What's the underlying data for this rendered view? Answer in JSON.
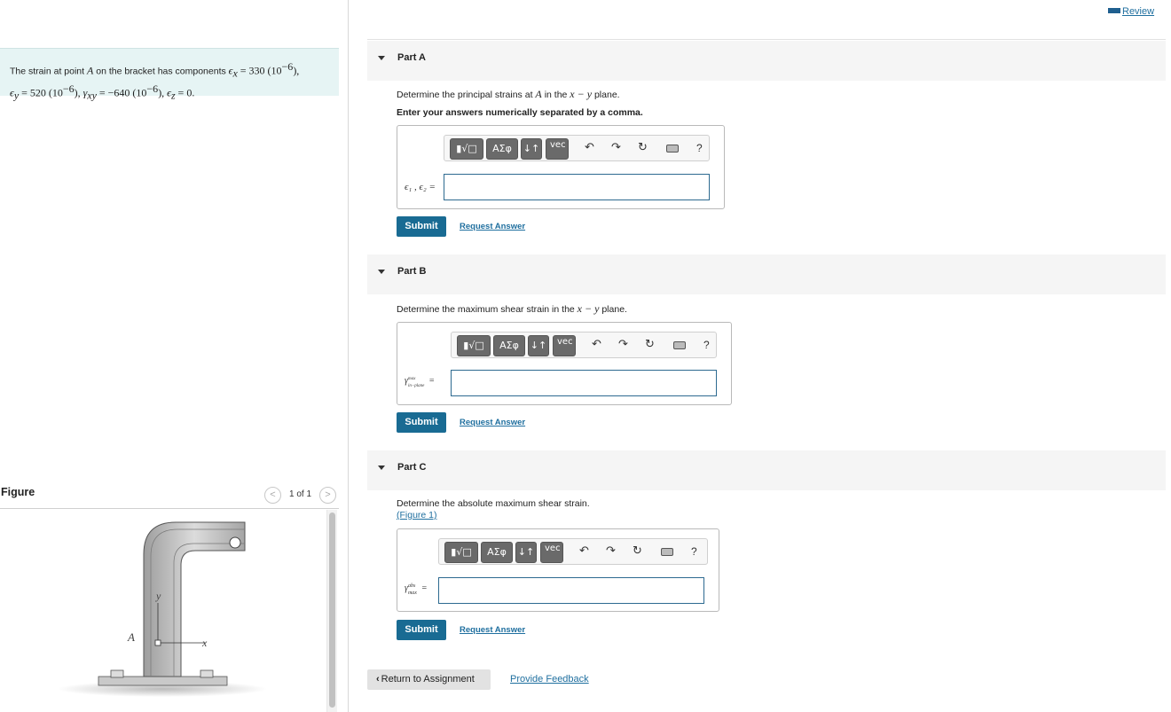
{
  "header": {
    "review_label": "Review"
  },
  "problem": {
    "text_prefix": "The strain at point",
    "point": "A",
    "text_mid": "on the bracket has components",
    "ex_sym": "ϵ",
    "ex_sub": "x",
    "ex_val": "= 330 (10",
    "ex_exp": "−6",
    "ex_end": "),",
    "ey_sym": "ϵ",
    "ey_sub": "y",
    "ey_val": "= 520 (10",
    "ey_exp": "−6",
    "ey_end": "),",
    "gxy_sym": "γ",
    "gxy_sub": "xy",
    "gxy_val": "= −640 (10",
    "gxy_exp": "−6",
    "gxy_end": "),",
    "ez_sym": "ϵ",
    "ez_sub": "z",
    "ez_val": "= 0."
  },
  "figure_panel": {
    "title": "Figure",
    "prev": "<",
    "next": ">",
    "page_indicator": "1 of 1",
    "labels": {
      "point": "A",
      "y_axis": "y",
      "x_axis": "x"
    }
  },
  "parts": [
    {
      "label": "Part A",
      "question_prefix": "Determine the principal strains at",
      "question_var": "A",
      "question_mid": "in the",
      "question_plane": "x − y",
      "question_suffix": "plane.",
      "instruction": "Enter your answers numerically separated by a comma.",
      "var_label": "ϵ₁ , ϵ₂ =",
      "submit": "Submit",
      "request": "Request Answer"
    },
    {
      "label": "Part B",
      "question_prefix": "Determine the maximum shear strain in the",
      "question_plane": "x − y",
      "question_suffix": "plane.",
      "var_label_main": "γ",
      "var_label_sup": "max",
      "var_label_sub": "in−plane",
      "var_eq": "=",
      "submit": "Submit",
      "request": "Request Answer"
    },
    {
      "label": "Part C",
      "question": "Determine the absolute maximum shear strain.",
      "figure_link": "(Figure 1)",
      "var_label_main": "γ",
      "var_label_sup": "abs",
      "var_label_sub": "max",
      "var_eq": "=",
      "submit": "Submit",
      "request": "Request Answer"
    }
  ],
  "toolbar": {
    "templates": "▮√□",
    "greek": "ΑΣφ",
    "arrows": "↓↑",
    "vec": "vec",
    "undo": "↶",
    "redo": "↷",
    "reset": "↻",
    "help": "?"
  },
  "footer": {
    "return": "Return to Assignment",
    "feedback": "Provide Feedback"
  }
}
